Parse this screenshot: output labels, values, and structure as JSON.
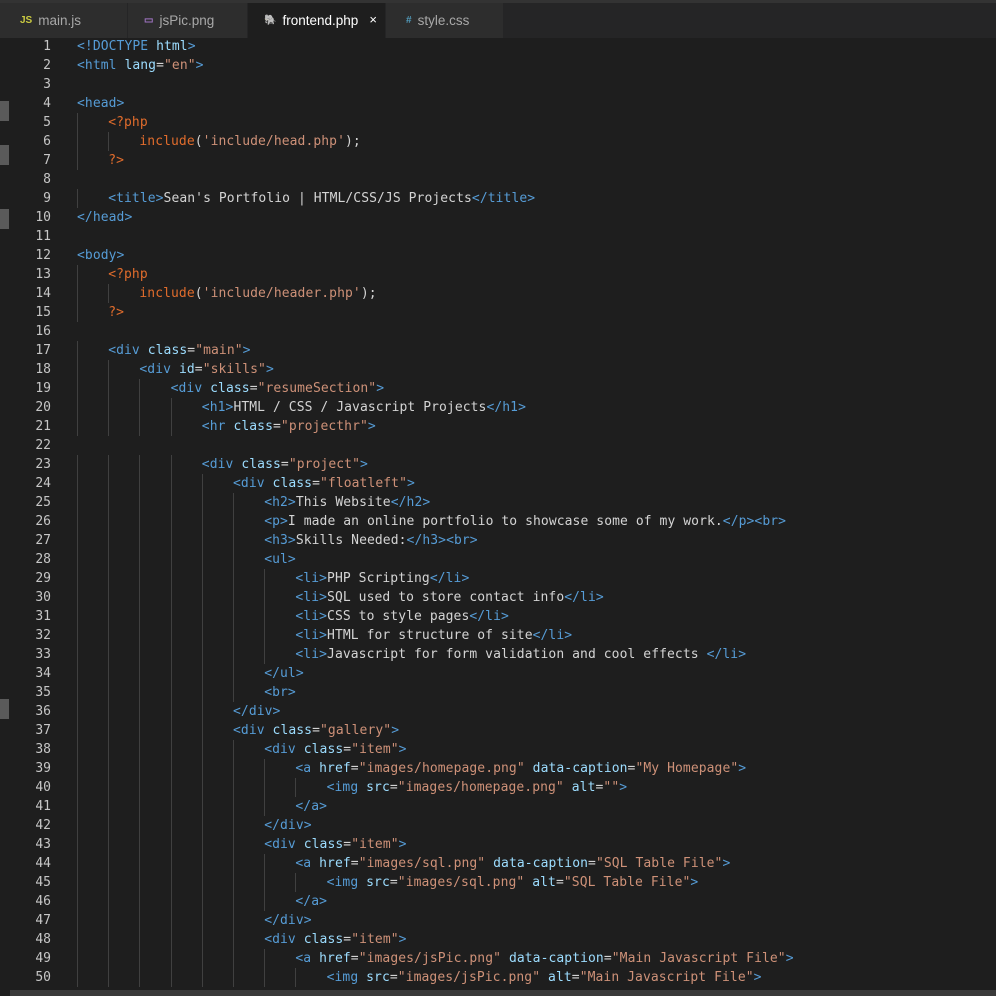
{
  "tabs": [
    {
      "icon_text": "JS",
      "icon_color": "#cbcb41",
      "icon_name": "javascript-file-icon",
      "label": "main.js",
      "active": false,
      "width": 128
    },
    {
      "icon_text": "▭",
      "icon_color": "#a074c4",
      "icon_name": "image-file-icon",
      "label": "jsPic.png",
      "active": false,
      "width": 120
    },
    {
      "icon_text": "🐘",
      "icon_color": "#a074c4",
      "icon_name": "php-file-icon",
      "label": "frontend.php",
      "active": true,
      "width": 138,
      "close": "×"
    },
    {
      "icon_text": "#",
      "icon_color": "#519aba",
      "icon_name": "css-file-icon",
      "label": "style.css",
      "active": false,
      "width": 118
    }
  ],
  "colors": {
    "tag": "#569cd6",
    "attr": "#9cdcfe",
    "string": "#ce9178",
    "php": "#e06c2c",
    "func": "#dcb67a",
    "text": "#d4d4d4"
  },
  "lines": [
    {
      "n": "1",
      "indent": 0,
      "tokens": [
        [
          "tag",
          "<!DOCTYPE "
        ],
        [
          "attr",
          "html"
        ],
        [
          "tag",
          ">"
        ]
      ]
    },
    {
      "n": "2",
      "indent": 0,
      "tokens": [
        [
          "tag",
          "<html "
        ],
        [
          "attr",
          "lang"
        ],
        [
          "txt",
          "="
        ],
        [
          "str",
          "\"en\""
        ],
        [
          "tag",
          ">"
        ]
      ]
    },
    {
      "n": "3",
      "indent": 0,
      "tokens": []
    },
    {
      "n": "4",
      "indent": 0,
      "tokens": [
        [
          "tag",
          "<head>"
        ]
      ]
    },
    {
      "n": "5",
      "indent": 1,
      "tokens": [
        [
          "php",
          "<?php"
        ]
      ]
    },
    {
      "n": "6",
      "indent": 2,
      "tokens": [
        [
          "php",
          "include"
        ],
        [
          "txt",
          "("
        ],
        [
          "str",
          "'include/head.php'"
        ],
        [
          "txt",
          ");"
        ]
      ]
    },
    {
      "n": "7",
      "indent": 1,
      "tokens": [
        [
          "php",
          "?>"
        ]
      ]
    },
    {
      "n": "8",
      "indent": 0,
      "tokens": []
    },
    {
      "n": "9",
      "indent": 1,
      "tokens": [
        [
          "tag",
          "<title>"
        ],
        [
          "txt",
          "Sean's Portfolio | HTML/CSS/JS Projects"
        ],
        [
          "tag",
          "</title>"
        ]
      ]
    },
    {
      "n": "10",
      "indent": 0,
      "tokens": [
        [
          "tag",
          "</head>"
        ]
      ]
    },
    {
      "n": "11",
      "indent": 0,
      "tokens": []
    },
    {
      "n": "12",
      "indent": 0,
      "tokens": [
        [
          "tag",
          "<body>"
        ]
      ]
    },
    {
      "n": "13",
      "indent": 1,
      "tokens": [
        [
          "php",
          "<?php"
        ]
      ]
    },
    {
      "n": "14",
      "indent": 2,
      "tokens": [
        [
          "php",
          "include"
        ],
        [
          "txt",
          "("
        ],
        [
          "str",
          "'include/header.php'"
        ],
        [
          "txt",
          ");"
        ]
      ]
    },
    {
      "n": "15",
      "indent": 1,
      "tokens": [
        [
          "php",
          "?>"
        ]
      ]
    },
    {
      "n": "16",
      "indent": 0,
      "tokens": []
    },
    {
      "n": "17",
      "indent": 1,
      "tokens": [
        [
          "tag",
          "<div "
        ],
        [
          "attr",
          "class"
        ],
        [
          "txt",
          "="
        ],
        [
          "str",
          "\"main\""
        ],
        [
          "tag",
          ">"
        ]
      ]
    },
    {
      "n": "18",
      "indent": 2,
      "tokens": [
        [
          "tag",
          "<div "
        ],
        [
          "attr",
          "id"
        ],
        [
          "txt",
          "="
        ],
        [
          "str",
          "\"skills\""
        ],
        [
          "tag",
          ">"
        ]
      ]
    },
    {
      "n": "19",
      "indent": 3,
      "tokens": [
        [
          "tag",
          "<div "
        ],
        [
          "attr",
          "class"
        ],
        [
          "txt",
          "="
        ],
        [
          "str",
          "\"resumeSection\""
        ],
        [
          "tag",
          ">"
        ]
      ]
    },
    {
      "n": "20",
      "indent": 4,
      "tokens": [
        [
          "tag",
          "<h1>"
        ],
        [
          "txt",
          "HTML / CSS / Javascript Projects"
        ],
        [
          "tag",
          "</h1>"
        ]
      ]
    },
    {
      "n": "21",
      "indent": 4,
      "tokens": [
        [
          "tag",
          "<hr "
        ],
        [
          "attr",
          "class"
        ],
        [
          "txt",
          "="
        ],
        [
          "str",
          "\"projecthr\""
        ],
        [
          "tag",
          ">"
        ]
      ]
    },
    {
      "n": "22",
      "indent": 0,
      "tokens": []
    },
    {
      "n": "23",
      "indent": 4,
      "tokens": [
        [
          "tag",
          "<div "
        ],
        [
          "attr",
          "class"
        ],
        [
          "txt",
          "="
        ],
        [
          "str",
          "\"project\""
        ],
        [
          "tag",
          ">"
        ]
      ]
    },
    {
      "n": "24",
      "indent": 5,
      "tokens": [
        [
          "tag",
          "<div "
        ],
        [
          "attr",
          "class"
        ],
        [
          "txt",
          "="
        ],
        [
          "str",
          "\"floatleft\""
        ],
        [
          "tag",
          ">"
        ]
      ]
    },
    {
      "n": "25",
      "indent": 6,
      "tokens": [
        [
          "tag",
          "<h2>"
        ],
        [
          "txt",
          "This Website"
        ],
        [
          "tag",
          "</h2>"
        ]
      ]
    },
    {
      "n": "26",
      "indent": 6,
      "tokens": [
        [
          "tag",
          "<p>"
        ],
        [
          "txt",
          "I made an online portfolio to showcase some of my work."
        ],
        [
          "tag",
          "</p><br>"
        ]
      ]
    },
    {
      "n": "27",
      "indent": 6,
      "tokens": [
        [
          "tag",
          "<h3>"
        ],
        [
          "txt",
          "Skills Needed:"
        ],
        [
          "tag",
          "</h3><br>"
        ]
      ]
    },
    {
      "n": "28",
      "indent": 6,
      "tokens": [
        [
          "tag",
          "<ul>"
        ]
      ]
    },
    {
      "n": "29",
      "indent": 7,
      "tokens": [
        [
          "tag",
          "<li>"
        ],
        [
          "txt",
          "PHP Scripting"
        ],
        [
          "tag",
          "</li>"
        ]
      ]
    },
    {
      "n": "30",
      "indent": 7,
      "tokens": [
        [
          "tag",
          "<li>"
        ],
        [
          "txt",
          "SQL used to store contact info"
        ],
        [
          "tag",
          "</li>"
        ]
      ]
    },
    {
      "n": "31",
      "indent": 7,
      "tokens": [
        [
          "tag",
          "<li>"
        ],
        [
          "txt",
          "CSS to style pages"
        ],
        [
          "tag",
          "</li>"
        ]
      ]
    },
    {
      "n": "32",
      "indent": 7,
      "tokens": [
        [
          "tag",
          "<li>"
        ],
        [
          "txt",
          "HTML for structure of site"
        ],
        [
          "tag",
          "</li>"
        ]
      ]
    },
    {
      "n": "33",
      "indent": 7,
      "tokens": [
        [
          "tag",
          "<li>"
        ],
        [
          "txt",
          "Javascript for form validation and cool effects "
        ],
        [
          "tag",
          "</li>"
        ]
      ]
    },
    {
      "n": "34",
      "indent": 6,
      "tokens": [
        [
          "tag",
          "</ul>"
        ]
      ]
    },
    {
      "n": "35",
      "indent": 6,
      "tokens": [
        [
          "tag",
          "<br>"
        ]
      ]
    },
    {
      "n": "36",
      "indent": 5,
      "tokens": [
        [
          "tag",
          "</div>"
        ]
      ]
    },
    {
      "n": "37",
      "indent": 5,
      "tokens": [
        [
          "tag",
          "<div "
        ],
        [
          "attr",
          "class"
        ],
        [
          "txt",
          "="
        ],
        [
          "str",
          "\"gallery\""
        ],
        [
          "tag",
          ">"
        ]
      ]
    },
    {
      "n": "38",
      "indent": 6,
      "tokens": [
        [
          "tag",
          "<div "
        ],
        [
          "attr",
          "class"
        ],
        [
          "txt",
          "="
        ],
        [
          "str",
          "\"item\""
        ],
        [
          "tag",
          ">"
        ]
      ]
    },
    {
      "n": "39",
      "indent": 7,
      "tokens": [
        [
          "tag",
          "<a "
        ],
        [
          "attr",
          "href"
        ],
        [
          "txt",
          "="
        ],
        [
          "str",
          "\"images/homepage.png\""
        ],
        [
          "txt",
          " "
        ],
        [
          "attr",
          "data-caption"
        ],
        [
          "txt",
          "="
        ],
        [
          "str",
          "\"My Homepage\""
        ],
        [
          "tag",
          ">"
        ]
      ]
    },
    {
      "n": "40",
      "indent": 8,
      "tokens": [
        [
          "tag",
          "<img "
        ],
        [
          "attr",
          "src"
        ],
        [
          "txt",
          "="
        ],
        [
          "str",
          "\"images/homepage.png\""
        ],
        [
          "txt",
          " "
        ],
        [
          "attr",
          "alt"
        ],
        [
          "txt",
          "="
        ],
        [
          "str",
          "\"\""
        ],
        [
          "tag",
          ">"
        ]
      ]
    },
    {
      "n": "41",
      "indent": 7,
      "tokens": [
        [
          "tag",
          "</a>"
        ]
      ]
    },
    {
      "n": "42",
      "indent": 6,
      "tokens": [
        [
          "tag",
          "</div>"
        ]
      ]
    },
    {
      "n": "43",
      "indent": 6,
      "tokens": [
        [
          "tag",
          "<div "
        ],
        [
          "attr",
          "class"
        ],
        [
          "txt",
          "="
        ],
        [
          "str",
          "\"item\""
        ],
        [
          "tag",
          ">"
        ]
      ]
    },
    {
      "n": "44",
      "indent": 7,
      "tokens": [
        [
          "tag",
          "<a "
        ],
        [
          "attr",
          "href"
        ],
        [
          "txt",
          "="
        ],
        [
          "str",
          "\"images/sql.png\""
        ],
        [
          "txt",
          " "
        ],
        [
          "attr",
          "data-caption"
        ],
        [
          "txt",
          "="
        ],
        [
          "str",
          "\"SQL Table File\""
        ],
        [
          "tag",
          ">"
        ]
      ]
    },
    {
      "n": "45",
      "indent": 8,
      "tokens": [
        [
          "tag",
          "<img "
        ],
        [
          "attr",
          "src"
        ],
        [
          "txt",
          "="
        ],
        [
          "str",
          "\"images/sql.png\""
        ],
        [
          "txt",
          " "
        ],
        [
          "attr",
          "alt"
        ],
        [
          "txt",
          "="
        ],
        [
          "str",
          "\"SQL Table File\""
        ],
        [
          "tag",
          ">"
        ]
      ]
    },
    {
      "n": "46",
      "indent": 7,
      "tokens": [
        [
          "tag",
          "</a>"
        ]
      ]
    },
    {
      "n": "47",
      "indent": 6,
      "tokens": [
        [
          "tag",
          "</div>"
        ]
      ]
    },
    {
      "n": "48",
      "indent": 6,
      "tokens": [
        [
          "tag",
          "<div "
        ],
        [
          "attr",
          "class"
        ],
        [
          "txt",
          "="
        ],
        [
          "str",
          "\"item\""
        ],
        [
          "tag",
          ">"
        ]
      ]
    },
    {
      "n": "49",
      "indent": 7,
      "tokens": [
        [
          "tag",
          "<a "
        ],
        [
          "attr",
          "href"
        ],
        [
          "txt",
          "="
        ],
        [
          "str",
          "\"images/jsPic.png\""
        ],
        [
          "txt",
          " "
        ],
        [
          "attr",
          "data-caption"
        ],
        [
          "txt",
          "="
        ],
        [
          "str",
          "\"Main Javascript File\""
        ],
        [
          "tag",
          ">"
        ]
      ]
    },
    {
      "n": "50",
      "indent": 8,
      "tokens": [
        [
          "tag",
          "<img "
        ],
        [
          "attr",
          "src"
        ],
        [
          "txt",
          "="
        ],
        [
          "str",
          "\"images/jsPic.png\""
        ],
        [
          "txt",
          " "
        ],
        [
          "attr",
          "alt"
        ],
        [
          "txt",
          "="
        ],
        [
          "str",
          "\"Main Javascript File\""
        ],
        [
          "tag",
          ">"
        ]
      ]
    }
  ]
}
